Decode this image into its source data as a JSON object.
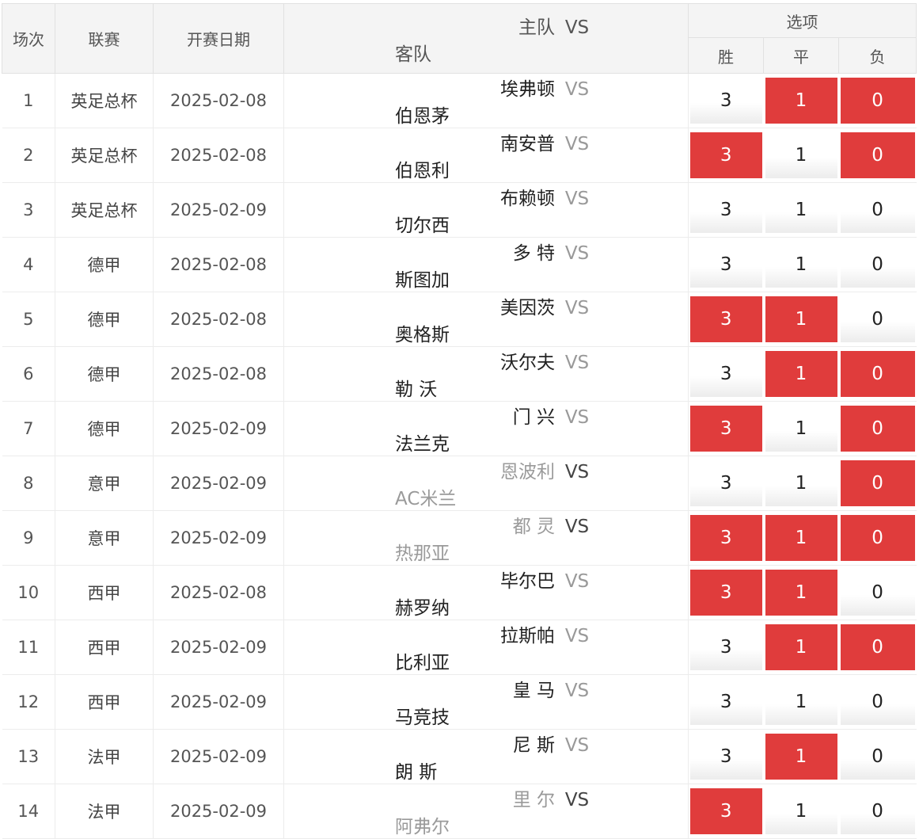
{
  "header": {
    "no": "场次",
    "league": "联赛",
    "date": "开赛日期",
    "home": "主队",
    "vs": "VS",
    "away": "客队",
    "options": "选项",
    "win": "胜",
    "draw": "平",
    "lose": "负"
  },
  "colors": {
    "selected": "#e03c3c",
    "header_bg": "#f4f4f4"
  },
  "rows": [
    {
      "no": "1",
      "league": "英足总杯",
      "date": "2025-02-08",
      "home": "埃弗顿",
      "vs": "VS",
      "away": "伯恩茅",
      "win": "3",
      "draw": "1",
      "lose": "0",
      "sel_win": false,
      "sel_draw": true,
      "sel_lose": true,
      "dim": false
    },
    {
      "no": "2",
      "league": "英足总杯",
      "date": "2025-02-08",
      "home": "南安普",
      "vs": "VS",
      "away": "伯恩利",
      "win": "3",
      "draw": "1",
      "lose": "0",
      "sel_win": true,
      "sel_draw": false,
      "sel_lose": true,
      "dim": false
    },
    {
      "no": "3",
      "league": "英足总杯",
      "date": "2025-02-09",
      "home": "布赖顿",
      "vs": "VS",
      "away": "切尔西",
      "win": "3",
      "draw": "1",
      "lose": "0",
      "sel_win": false,
      "sel_draw": false,
      "sel_lose": false,
      "dim": false
    },
    {
      "no": "4",
      "league": "德甲",
      "date": "2025-02-08",
      "home": "多 特",
      "vs": "VS",
      "away": "斯图加",
      "win": "3",
      "draw": "1",
      "lose": "0",
      "sel_win": false,
      "sel_draw": false,
      "sel_lose": false,
      "dim": false
    },
    {
      "no": "5",
      "league": "德甲",
      "date": "2025-02-08",
      "home": "美因茨",
      "vs": "VS",
      "away": "奥格斯",
      "win": "3",
      "draw": "1",
      "lose": "0",
      "sel_win": true,
      "sel_draw": true,
      "sel_lose": false,
      "dim": false
    },
    {
      "no": "6",
      "league": "德甲",
      "date": "2025-02-08",
      "home": "沃尔夫",
      "vs": "VS",
      "away": "勒 沃",
      "win": "3",
      "draw": "1",
      "lose": "0",
      "sel_win": false,
      "sel_draw": true,
      "sel_lose": true,
      "dim": false
    },
    {
      "no": "7",
      "league": "德甲",
      "date": "2025-02-09",
      "home": "门 兴",
      "vs": "VS",
      "away": "法兰克",
      "win": "3",
      "draw": "1",
      "lose": "0",
      "sel_win": true,
      "sel_draw": false,
      "sel_lose": true,
      "dim": false
    },
    {
      "no": "8",
      "league": "意甲",
      "date": "2025-02-09",
      "home": "恩波利",
      "vs": "VS",
      "away": "AC米兰",
      "win": "3",
      "draw": "1",
      "lose": "0",
      "sel_win": false,
      "sel_draw": false,
      "sel_lose": true,
      "dim": true
    },
    {
      "no": "9",
      "league": "意甲",
      "date": "2025-02-09",
      "home": "都 灵",
      "vs": "VS",
      "away": "热那亚",
      "win": "3",
      "draw": "1",
      "lose": "0",
      "sel_win": true,
      "sel_draw": true,
      "sel_lose": true,
      "dim": true
    },
    {
      "no": "10",
      "league": "西甲",
      "date": "2025-02-08",
      "home": "毕尔巴",
      "vs": "VS",
      "away": "赫罗纳",
      "win": "3",
      "draw": "1",
      "lose": "0",
      "sel_win": true,
      "sel_draw": true,
      "sel_lose": false,
      "dim": false
    },
    {
      "no": "11",
      "league": "西甲",
      "date": "2025-02-09",
      "home": "拉斯帕",
      "vs": "VS",
      "away": "比利亚",
      "win": "3",
      "draw": "1",
      "lose": "0",
      "sel_win": false,
      "sel_draw": true,
      "sel_lose": true,
      "dim": false
    },
    {
      "no": "12",
      "league": "西甲",
      "date": "2025-02-09",
      "home": "皇 马",
      "vs": "VS",
      "away": "马竞技",
      "win": "3",
      "draw": "1",
      "lose": "0",
      "sel_win": false,
      "sel_draw": false,
      "sel_lose": false,
      "dim": false
    },
    {
      "no": "13",
      "league": "法甲",
      "date": "2025-02-09",
      "home": "尼 斯",
      "vs": "VS",
      "away": "朗 斯",
      "win": "3",
      "draw": "1",
      "lose": "0",
      "sel_win": false,
      "sel_draw": true,
      "sel_lose": false,
      "dim": false
    },
    {
      "no": "14",
      "league": "法甲",
      "date": "2025-02-09",
      "home": "里 尔",
      "vs": "VS",
      "away": "阿弗尔",
      "win": "3",
      "draw": "1",
      "lose": "0",
      "sel_win": true,
      "sel_draw": false,
      "sel_lose": false,
      "dim": true
    }
  ]
}
